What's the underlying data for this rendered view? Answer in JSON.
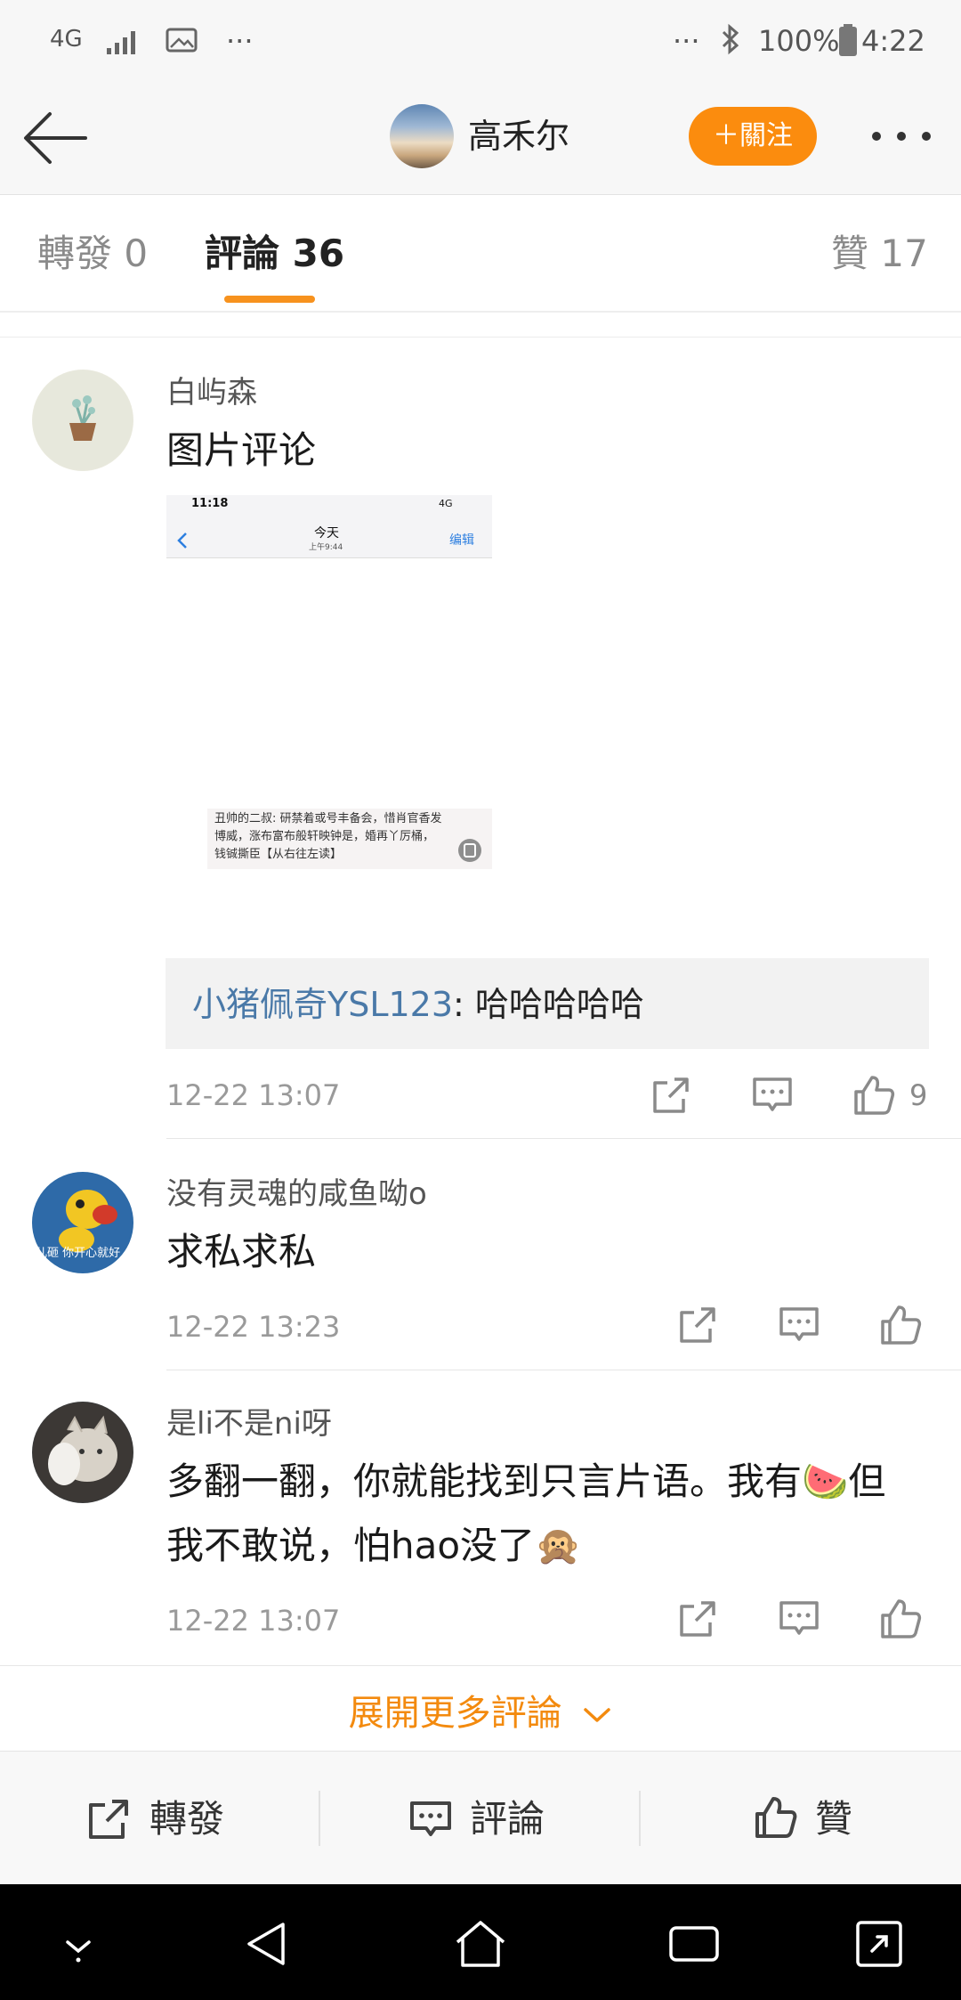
{
  "status_bar": {
    "network": "4G",
    "more_left": "···",
    "more_right": "···",
    "battery": "100%",
    "time": "4:22"
  },
  "nav": {
    "title": "高禾尔",
    "follow_label": "＋關注"
  },
  "tabs": [
    {
      "label": "轉發",
      "count": "0"
    },
    {
      "label": "評論",
      "count": "36"
    },
    {
      "label": "贊",
      "count": "17"
    }
  ],
  "comments": [
    {
      "user": "白屿森",
      "text": "图片评论",
      "image": {
        "status_time": "11:18",
        "status_signal": "4G",
        "header_title": "今天",
        "header_subtitle": "上午9:44",
        "edit_label": "编辑",
        "message_line1": "丑帅的二叔: 研禁着或号丰备会，惜肖官香发",
        "message_line2": "博威，涨布富布般轩映钟是，婚再丫厉桶，",
        "message_line3": "钱铖撕臣【从右往左读】"
      },
      "reply": {
        "user": "小猪佩奇YSL123",
        "text": ": 哈哈哈哈哈"
      },
      "time": "12-22 13:07",
      "likes": "9"
    },
    {
      "user": "没有灵魂的咸鱼呦o",
      "avatar_caption": "儿砸 你开心就好",
      "text": "求私求私",
      "time": "12-22 13:23"
    },
    {
      "user": "是li不是ni呀",
      "text_line1": "多翻一翻，你就能找到只言片语。我有🍉但",
      "text_line2": "我不敢说，怕hao没了🙊",
      "time": "12-22 13:07"
    }
  ],
  "expand_label": "展開更多評論",
  "bottom_bar": {
    "repost": "轉發",
    "comment": "評論",
    "like": "贊"
  },
  "colors": {
    "accent": "#f7921e",
    "follow_button": "#fb8c0e",
    "link": "#4a79a8"
  }
}
